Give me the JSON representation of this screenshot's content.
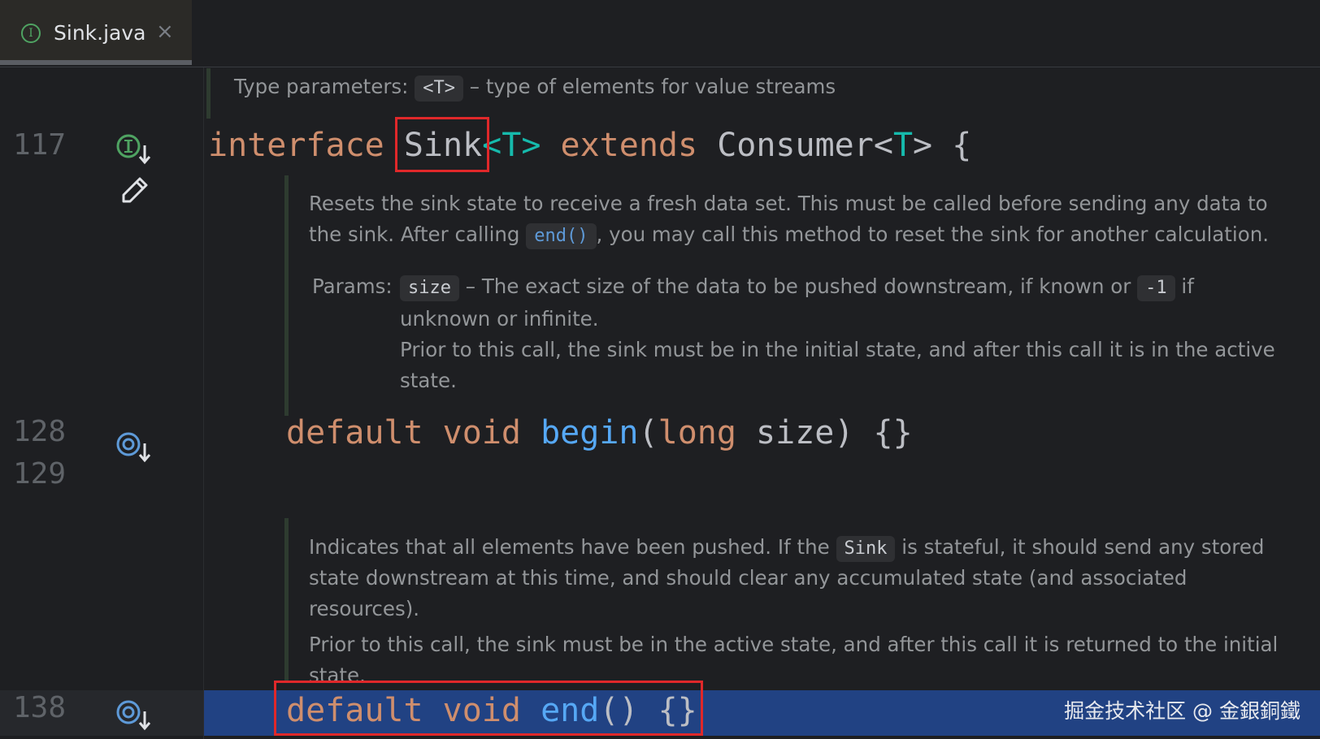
{
  "tab": {
    "label": "Sink.java",
    "close": "×",
    "icon": "interface-icon",
    "icon_glyph": "I"
  },
  "gutter": {
    "lines": [
      "117",
      "128",
      "129",
      "138"
    ],
    "icons": [
      "implemented-interface-icon",
      "edit-pencil-icon",
      "overridden-method-icon",
      "overridden-method-icon"
    ]
  },
  "doc1": {
    "label": "Type parameters:",
    "chip": "<T>",
    "text": "– type of elements for value streams"
  },
  "line117": {
    "kw_interface": "interface",
    "name": "Sink",
    "tp1": "<T>",
    "kw_extends": "extends",
    "parent": "Consumer",
    "tp2_open": "<",
    "tp2_t": "T",
    "tp2_close": ">",
    "brace": "{"
  },
  "doc2": {
    "p1a": "Resets the sink state to receive a fresh data set. This must be called before sending any data to",
    "p1b": "the sink. After calling",
    "p1b_chip": "end()",
    "p1b_rest": ", you may call this method to reset the sink for another calculation.",
    "params_label": "Params:",
    "params_chip": "size",
    "params_text": "– The exact size of the data to be pushed downstream, if known or",
    "params_chip2": "-1",
    "params_if": "if",
    "params_line2": "unknown or infinite.",
    "params_line3": "Prior to this call, the sink must be in the initial state, and after this call it is in the active",
    "params_line4": "state."
  },
  "line128": {
    "kw_default": "default",
    "kw_void": "void",
    "fn": "begin",
    "paren_open": "(",
    "kw_long": "long",
    "param": "size",
    "rest": ") {}"
  },
  "doc3": {
    "p1a": "Indicates that all elements have been pushed. If the",
    "p1_chip": "Sink",
    "p1b": "is stateful, it should send any stored",
    "p2": "state downstream at this time, and should clear any accumulated state (and associated resources).",
    "p3": "Prior to this call, the sink must be in the active state, and after this call it is returned to the initial",
    "p4": "state."
  },
  "line138": {
    "kw_default": "default",
    "kw_void": "void",
    "fn": "end",
    "rest": "() {}"
  },
  "watermark": "掘金技术社区 @ 金銀銅鐵",
  "colors": {
    "background": "#1e1f22",
    "keyword": "#cf8e6d",
    "type_param": "#16baac",
    "function": "#56a8f5",
    "highlight_row": "#214283",
    "annotation_red": "#e0282a"
  }
}
